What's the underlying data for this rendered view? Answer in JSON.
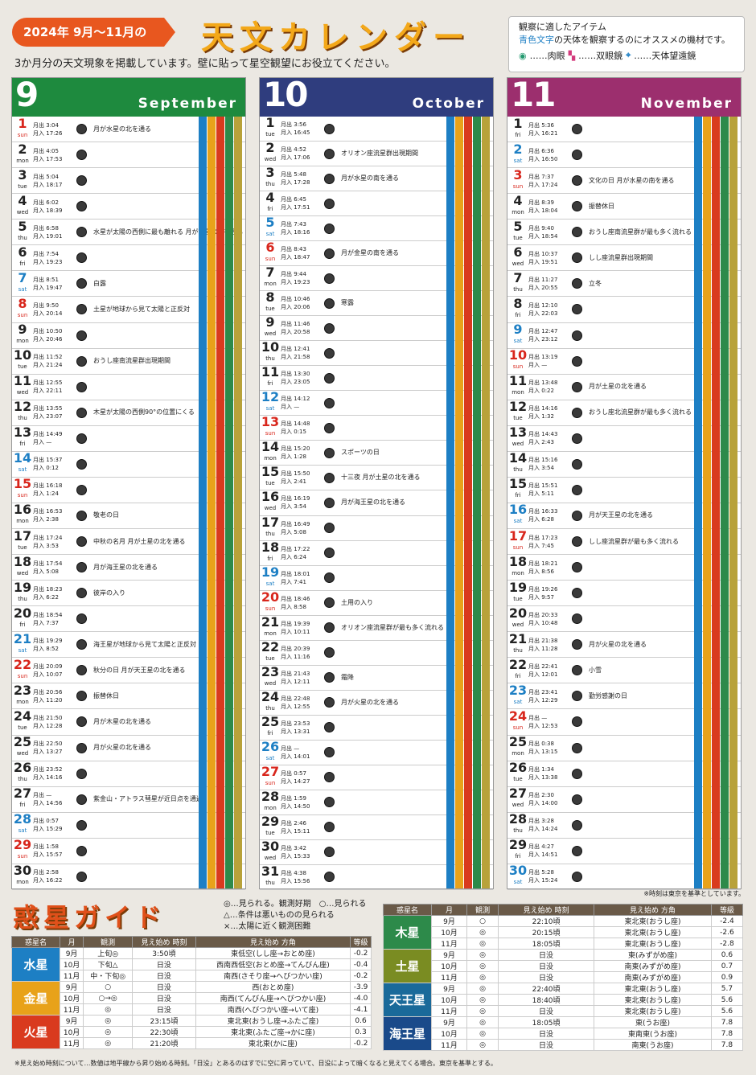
{
  "header": {
    "pill": "2024年 9月〜11月の",
    "title": "天文カレンダー",
    "lead": "3か月分の天文現象を掲載しています。壁に貼って星空観望にお役立てください。"
  },
  "legend": {
    "title": "観察に適したアイテム",
    "desc_blue": "青色文字",
    "desc_rest": "の天体を観察するのにオススメの機材です。",
    "eye": "……肉眼",
    "bino": "……双眼鏡",
    "tele": "……天体望遠鏡"
  },
  "months": [
    {
      "num": "9",
      "en": "September",
      "color": "#1e8a3e",
      "days": [
        [
          "1",
          "sun",
          "3:04",
          "17:26",
          "月が水星の北を通る"
        ],
        [
          "2",
          "mon",
          "4:05",
          "17:53",
          ""
        ],
        [
          "3",
          "tue",
          "5:04",
          "18:17",
          ""
        ],
        [
          "4",
          "wed",
          "6:02",
          "18:39",
          ""
        ],
        [
          "5",
          "thu",
          "6:58",
          "19:01",
          "水星が太陽の西側に最も離れる 月が金星の南を通る"
        ],
        [
          "6",
          "fri",
          "7:54",
          "19:23",
          ""
        ],
        [
          "7",
          "sat",
          "8:51",
          "19:47",
          "白露"
        ],
        [
          "8",
          "sun",
          "9:50",
          "20:14",
          "土星が地球から見て太陽と正反対"
        ],
        [
          "9",
          "mon",
          "10:50",
          "20:46",
          ""
        ],
        [
          "10",
          "tue",
          "11:52",
          "21:24",
          "おうし座南流星群出現期間"
        ],
        [
          "11",
          "wed",
          "12:55",
          "22:11",
          ""
        ],
        [
          "12",
          "thu",
          "13:55",
          "23:07",
          "木星が太陽の西側90°の位置にくる"
        ],
        [
          "13",
          "fri",
          "14:49",
          "—",
          ""
        ],
        [
          "14",
          "sat",
          "15:37",
          "0:12",
          ""
        ],
        [
          "15",
          "sun",
          "16:18",
          "1:24",
          ""
        ],
        [
          "16",
          "mon",
          "16:53",
          "2:38",
          "敬老の日"
        ],
        [
          "17",
          "tue",
          "17:24",
          "3:53",
          "中秋の名月 月が土星の北を通る"
        ],
        [
          "18",
          "wed",
          "17:54",
          "5:08",
          "月が海王星の北を通る"
        ],
        [
          "19",
          "thu",
          "18:23",
          "6:22",
          "彼岸の入り"
        ],
        [
          "20",
          "fri",
          "18:54",
          "7:37",
          ""
        ],
        [
          "21",
          "sat",
          "19:29",
          "8:52",
          "海王星が地球から見て太陽と正反対"
        ],
        [
          "22",
          "sun",
          "20:09",
          "10:07",
          "秋分の日 月が天王星の北を通る"
        ],
        [
          "23",
          "mon",
          "20:56",
          "11:20",
          "振替休日"
        ],
        [
          "24",
          "tue",
          "21:50",
          "12:28",
          "月が木星の北を通る"
        ],
        [
          "25",
          "wed",
          "22:50",
          "13:27",
          "月が火星の北を通る"
        ],
        [
          "26",
          "thu",
          "23:52",
          "14:16",
          ""
        ],
        [
          "27",
          "fri",
          "—",
          "14:56",
          "紫金山・アトラス彗星が近日点を通過"
        ],
        [
          "28",
          "sat",
          "0:57",
          "15:29",
          ""
        ],
        [
          "29",
          "sun",
          "1:58",
          "15:57",
          ""
        ],
        [
          "30",
          "mon",
          "2:58",
          "16:22",
          ""
        ]
      ]
    },
    {
      "num": "10",
      "en": "October",
      "color": "#2f3d7e",
      "days": [
        [
          "1",
          "tue",
          "3:56",
          "16:45",
          ""
        ],
        [
          "2",
          "wed",
          "4:52",
          "17:06",
          "オリオン座流星群出現期間"
        ],
        [
          "3",
          "thu",
          "5:48",
          "17:28",
          "月が水星の南を通る"
        ],
        [
          "4",
          "fri",
          "6:45",
          "17:51",
          ""
        ],
        [
          "5",
          "sat",
          "7:43",
          "18:16",
          ""
        ],
        [
          "6",
          "sun",
          "8:43",
          "18:47",
          "月が金星の南を通る"
        ],
        [
          "7",
          "mon",
          "9:44",
          "19:23",
          ""
        ],
        [
          "8",
          "tue",
          "10:46",
          "20:06",
          "寒露"
        ],
        [
          "9",
          "wed",
          "11:46",
          "20:58",
          ""
        ],
        [
          "10",
          "thu",
          "12:41",
          "21:58",
          ""
        ],
        [
          "11",
          "fri",
          "13:30",
          "23:05",
          ""
        ],
        [
          "12",
          "sat",
          "14:12",
          "—",
          ""
        ],
        [
          "13",
          "sun",
          "14:48",
          "0:15",
          ""
        ],
        [
          "14",
          "mon",
          "15:20",
          "1:28",
          "スポーツの日"
        ],
        [
          "15",
          "tue",
          "15:50",
          "2:41",
          "十三夜 月が土星の北を通る"
        ],
        [
          "16",
          "wed",
          "16:19",
          "3:54",
          "月が海王星の北を通る"
        ],
        [
          "17",
          "thu",
          "16:49",
          "5:08",
          ""
        ],
        [
          "18",
          "fri",
          "17:22",
          "6:24",
          ""
        ],
        [
          "19",
          "sat",
          "18:01",
          "7:41",
          ""
        ],
        [
          "20",
          "sun",
          "18:46",
          "8:58",
          "土用の入り"
        ],
        [
          "21",
          "mon",
          "19:39",
          "10:11",
          "オリオン座流星群が最も多く流れる"
        ],
        [
          "22",
          "tue",
          "20:39",
          "11:16",
          ""
        ],
        [
          "23",
          "wed",
          "21:43",
          "12:11",
          "霜降"
        ],
        [
          "24",
          "thu",
          "22:48",
          "12:55",
          "月が火星の北を通る"
        ],
        [
          "25",
          "fri",
          "23:53",
          "13:31",
          ""
        ],
        [
          "26",
          "sat",
          "—",
          "14:01",
          ""
        ],
        [
          "27",
          "sun",
          "0:57",
          "14:27",
          ""
        ],
        [
          "28",
          "mon",
          "1:59",
          "14:50",
          ""
        ],
        [
          "29",
          "tue",
          "2:46",
          "15:11",
          ""
        ],
        [
          "30",
          "wed",
          "3:42",
          "15:33",
          ""
        ],
        [
          "31",
          "thu",
          "4:38",
          "15:56",
          ""
        ]
      ]
    },
    {
      "num": "11",
      "en": "November",
      "color": "#9c2f6e",
      "days": [
        [
          "1",
          "fri",
          "5:36",
          "16:21",
          ""
        ],
        [
          "2",
          "sat",
          "6:36",
          "16:50",
          ""
        ],
        [
          "3",
          "sun",
          "7:37",
          "17:24",
          "文化の日 月が水星の南を通る"
        ],
        [
          "4",
          "mon",
          "8:39",
          "18:04",
          "振替休日"
        ],
        [
          "5",
          "tue",
          "9:40",
          "18:54",
          "おうし座南流星群が最も多く流れる"
        ],
        [
          "6",
          "wed",
          "10:37",
          "19:51",
          "しし座流星群出現期間"
        ],
        [
          "7",
          "thu",
          "11:27",
          "20:55",
          "立冬"
        ],
        [
          "8",
          "fri",
          "12:10",
          "22:03",
          ""
        ],
        [
          "9",
          "sat",
          "12:47",
          "23:12",
          ""
        ],
        [
          "10",
          "sun",
          "13:19",
          "—",
          ""
        ],
        [
          "11",
          "mon",
          "13:48",
          "0:22",
          "月が土星の北を通る"
        ],
        [
          "12",
          "tue",
          "14:16",
          "1:32",
          "おうし座北流星群が最も多く流れる"
        ],
        [
          "13",
          "wed",
          "14:43",
          "2:43",
          ""
        ],
        [
          "14",
          "thu",
          "15:16",
          "3:54",
          ""
        ],
        [
          "15",
          "fri",
          "15:51",
          "5:11",
          ""
        ],
        [
          "16",
          "sat",
          "16:33",
          "6:28",
          "月が天王星の北を通る"
        ],
        [
          "17",
          "sun",
          "17:23",
          "7:45",
          "しし座流星群が最も多く流れる"
        ],
        [
          "18",
          "mon",
          "18:21",
          "8:56",
          ""
        ],
        [
          "19",
          "tue",
          "19:26",
          "9:57",
          ""
        ],
        [
          "20",
          "wed",
          "20:33",
          "10:48",
          ""
        ],
        [
          "21",
          "thu",
          "21:38",
          "11:28",
          "月が火星の北を通る"
        ],
        [
          "22",
          "fri",
          "22:41",
          "12:01",
          "小雪"
        ],
        [
          "23",
          "sat",
          "23:41",
          "12:29",
          "勤労感謝の日"
        ],
        [
          "24",
          "sun",
          "—",
          "12:53",
          ""
        ],
        [
          "25",
          "mon",
          "0:38",
          "13:15",
          ""
        ],
        [
          "26",
          "tue",
          "1:34",
          "13:38",
          ""
        ],
        [
          "27",
          "wed",
          "2:30",
          "14:00",
          ""
        ],
        [
          "28",
          "thu",
          "3:28",
          "14:24",
          ""
        ],
        [
          "29",
          "fri",
          "4:27",
          "14:51",
          ""
        ],
        [
          "30",
          "sat",
          "5:28",
          "15:24",
          ""
        ]
      ]
    }
  ],
  "note": "※時刻は東京を基準としています。",
  "guide": {
    "title": "惑星ガイド",
    "key": [
      "◎…見られる。観測好期　○…見られる",
      "△…条件は悪いものの見られる",
      "×…太陽に近く観測困難"
    ],
    "head": [
      "惑星名",
      "月",
      "観測",
      "見え始め 時刻",
      "見え始め 方角",
      "等級"
    ],
    "left": [
      [
        "水星",
        "#1d7fc4",
        [
          [
            "9月",
            "上旬◎",
            "3:50頃",
            "東低空(しし座→おとめ座)",
            "-0.2"
          ],
          [
            "10月",
            "下旬△",
            "日没",
            "西南西低空(おとめ座→てんびん座)",
            "-0.4"
          ],
          [
            "11月",
            "中・下旬◎",
            "日没",
            "南西(さそり座→へびつかい座)",
            "-0.2"
          ]
        ]
      ],
      [
        "金星",
        "#e8a21a",
        [
          [
            "9月",
            "○",
            "日没",
            "西(おとめ座)",
            "-3.9"
          ],
          [
            "10月",
            "○→◎",
            "日没",
            "南西(てんびん座→へびつかい座)",
            "-4.0"
          ],
          [
            "11月",
            "◎",
            "日没",
            "南西(へびつかい座→いて座)",
            "-4.1"
          ]
        ]
      ],
      [
        "火星",
        "#d93a1e",
        [
          [
            "9月",
            "◎",
            "23:15頃",
            "東北東(おうし座→ふたご座)",
            "0.6"
          ],
          [
            "10月",
            "◎",
            "22:30頃",
            "東北東(ふたご座→かに座)",
            "0.3"
          ],
          [
            "11月",
            "◎",
            "21:20頃",
            "東北東(かに座)",
            "-0.2"
          ]
        ]
      ]
    ],
    "right": [
      [
        "木星",
        "#2d8a4a",
        [
          [
            "9月",
            "○",
            "22:10頃",
            "東北東(おうし座)",
            "-2.4"
          ],
          [
            "10月",
            "◎",
            "20:15頃",
            "東北東(おうし座)",
            "-2.6"
          ],
          [
            "11月",
            "◎",
            "18:05頃",
            "東北東(おうし座)",
            "-2.8"
          ]
        ]
      ],
      [
        "土星",
        "#7a8c22",
        [
          [
            "9月",
            "◎",
            "日没",
            "東(みずがめ座)",
            "0.6"
          ],
          [
            "10月",
            "◎",
            "日没",
            "南東(みずがめ座)",
            "0.7"
          ],
          [
            "11月",
            "◎",
            "日没",
            "南東(みずがめ座)",
            "0.9"
          ]
        ]
      ],
      [
        "天王星",
        "#1a6a9a",
        [
          [
            "9月",
            "◎",
            "22:40頃",
            "東北東(おうし座)",
            "5.7"
          ],
          [
            "10月",
            "◎",
            "18:40頃",
            "東北東(おうし座)",
            "5.6"
          ],
          [
            "11月",
            "◎",
            "日没",
            "東北東(おうし座)",
            "5.6"
          ]
        ]
      ],
      [
        "海王星",
        "#1a4a8a",
        [
          [
            "9月",
            "◎",
            "18:05頃",
            "東(うお座)",
            "7.8"
          ],
          [
            "10月",
            "◎",
            "日没",
            "東南東(うお座)",
            "7.8"
          ],
          [
            "11月",
            "◎",
            "日没",
            "南東(うお座)",
            "7.8"
          ]
        ]
      ]
    ]
  },
  "footnote": "※見え始め時刻について…数値は地平線から昇り始める時刻。「日没」とあるのはすでに空に昇っていて、日没によって暗くなると見えてくる場合。東京を基準とする。"
}
